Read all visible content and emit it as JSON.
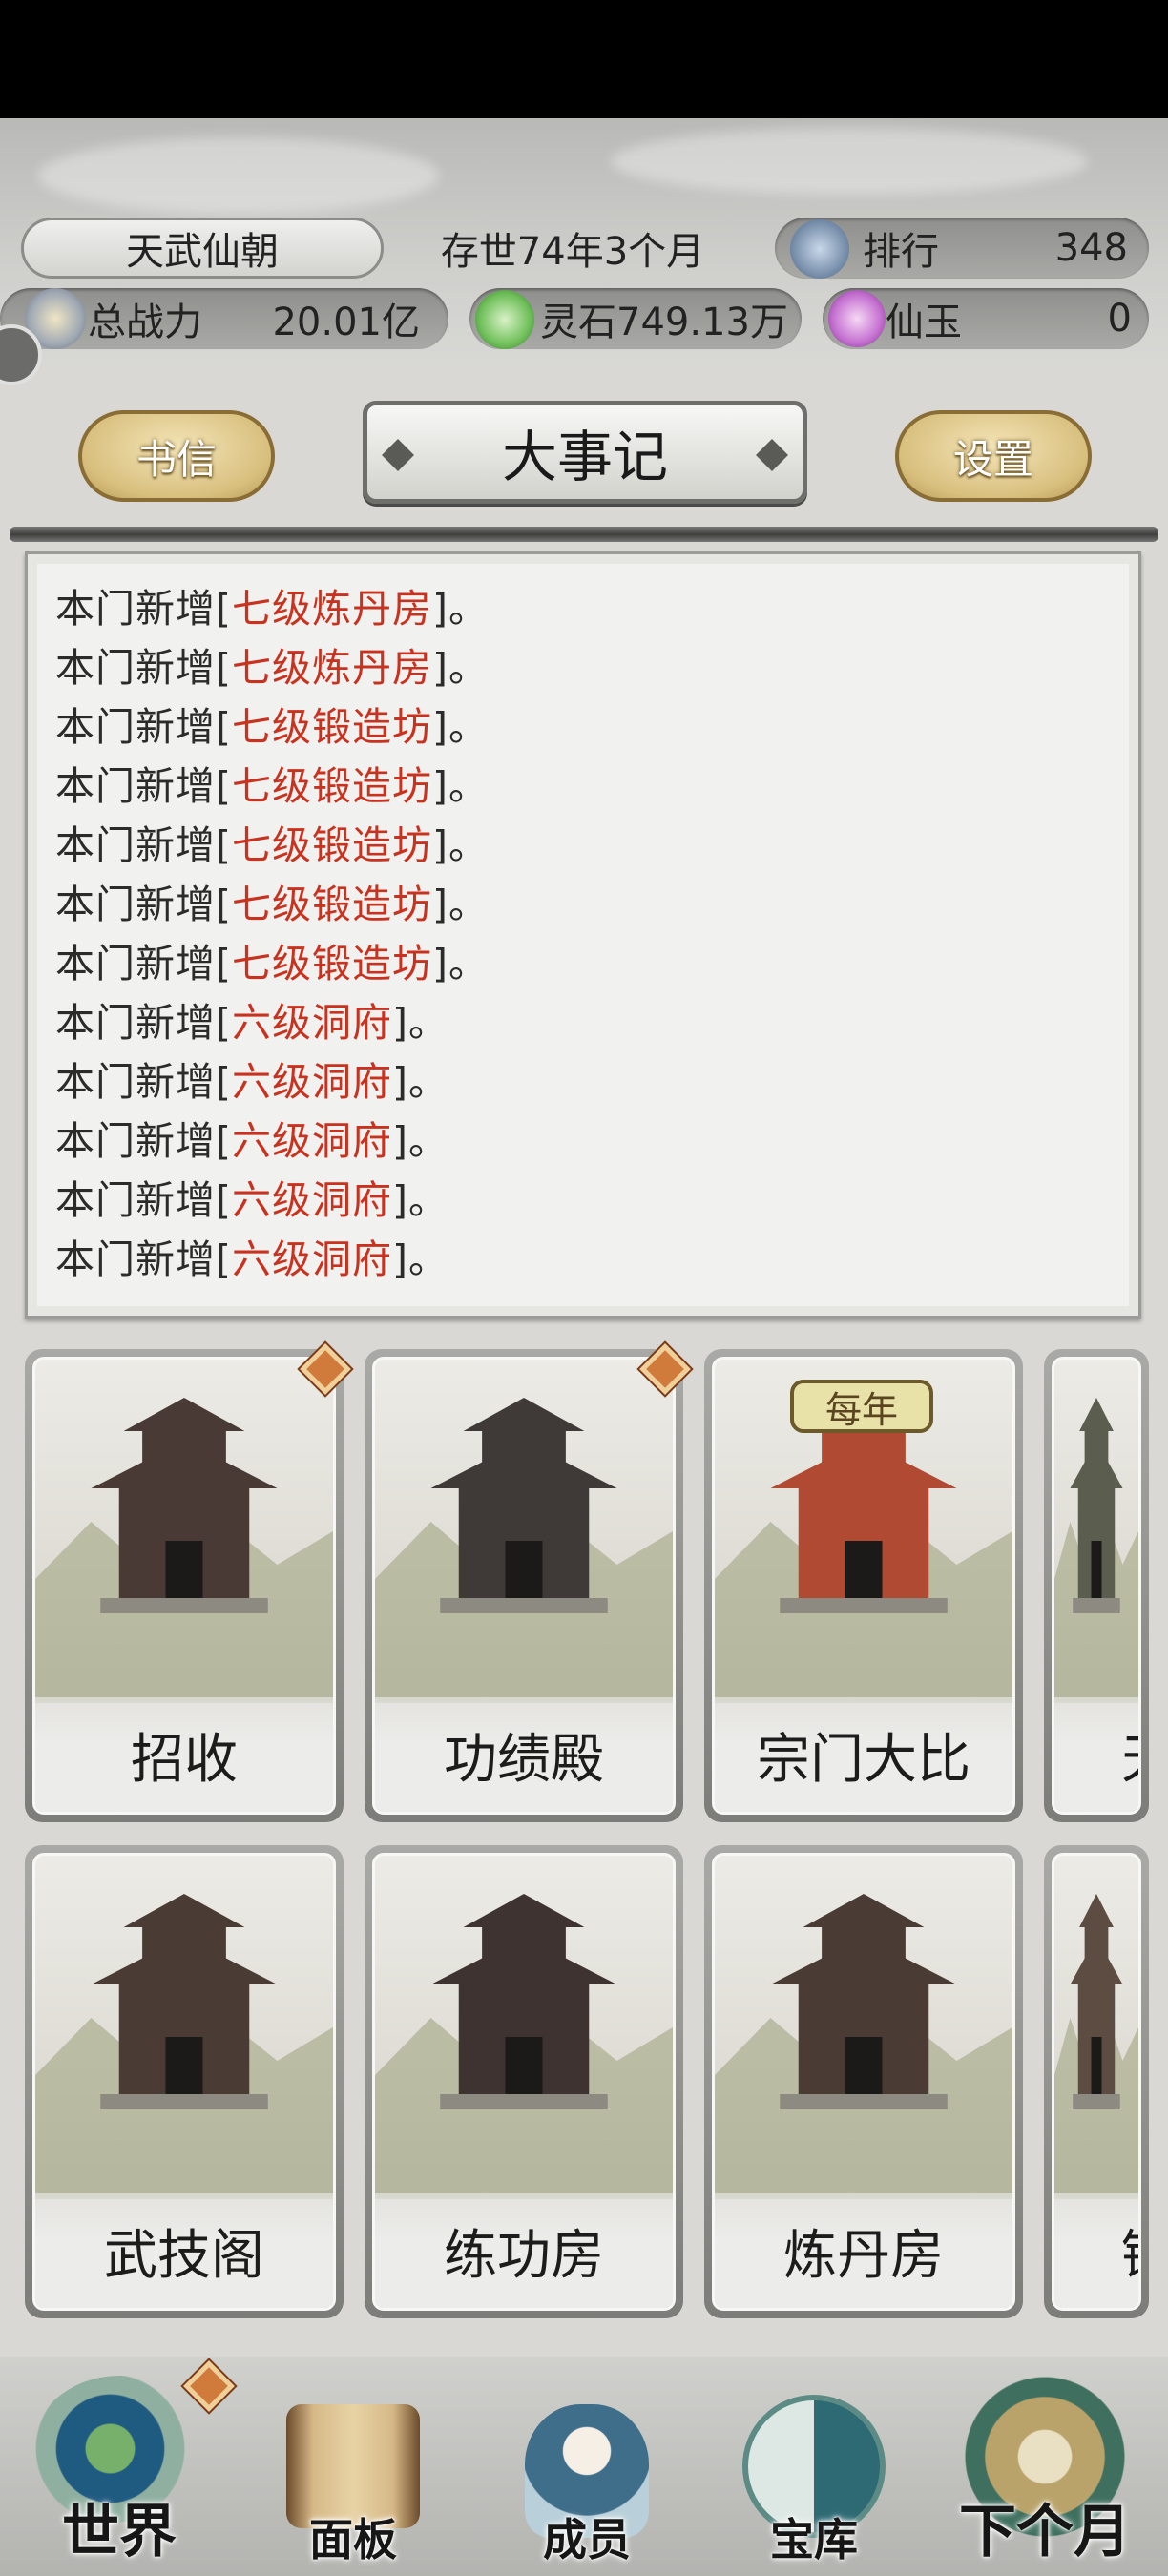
{
  "header": {
    "sect_name": "天武仙朝",
    "age_text": "存世74年3个月",
    "rank_label": "排行",
    "rank_value": "348",
    "power_label": "总战力",
    "power_value": "20.01亿",
    "stone_text": "灵石749.13万",
    "jade_label": "仙玉",
    "jade_value": "0"
  },
  "toolbar": {
    "letters_label": "书信",
    "title": "大事记",
    "settings_label": "设置"
  },
  "log": {
    "entries": [
      {
        "prefix": "本门新增[",
        "item": "七级炼丹房",
        "suffix": "]。"
      },
      {
        "prefix": "本门新增[",
        "item": "七级炼丹房",
        "suffix": "]。"
      },
      {
        "prefix": "本门新增[",
        "item": "七级锻造坊",
        "suffix": "]。"
      },
      {
        "prefix": "本门新增[",
        "item": "七级锻造坊",
        "suffix": "]。"
      },
      {
        "prefix": "本门新增[",
        "item": "七级锻造坊",
        "suffix": "]。"
      },
      {
        "prefix": "本门新增[",
        "item": "七级锻造坊",
        "suffix": "]。"
      },
      {
        "prefix": "本门新增[",
        "item": "七级锻造坊",
        "suffix": "]。"
      },
      {
        "prefix": "本门新增[",
        "item": "六级洞府",
        "suffix": "]。"
      },
      {
        "prefix": "本门新增[",
        "item": "六级洞府",
        "suffix": "]。"
      },
      {
        "prefix": "本门新增[",
        "item": "六级洞府",
        "suffix": "]。"
      },
      {
        "prefix": "本门新增[",
        "item": "六级洞府",
        "suffix": "]。"
      },
      {
        "prefix": "本门新增[",
        "item": "六级洞府",
        "suffix": "]。"
      }
    ]
  },
  "buildings": {
    "row1": [
      "招收",
      "功绩殿",
      "宗门大比",
      "天"
    ],
    "row2": [
      "武技阁",
      "练功房",
      "炼丹房",
      "锻"
    ],
    "yearly_tag": "每年"
  },
  "nav": {
    "world": "世界",
    "panel": "面板",
    "members": "成员",
    "treasury": "宝库",
    "next_month": "下个月"
  },
  "colors": {
    "highlight": "#c8321f",
    "gold_button": "#d8bf7e",
    "badge": "#d07a3c"
  }
}
